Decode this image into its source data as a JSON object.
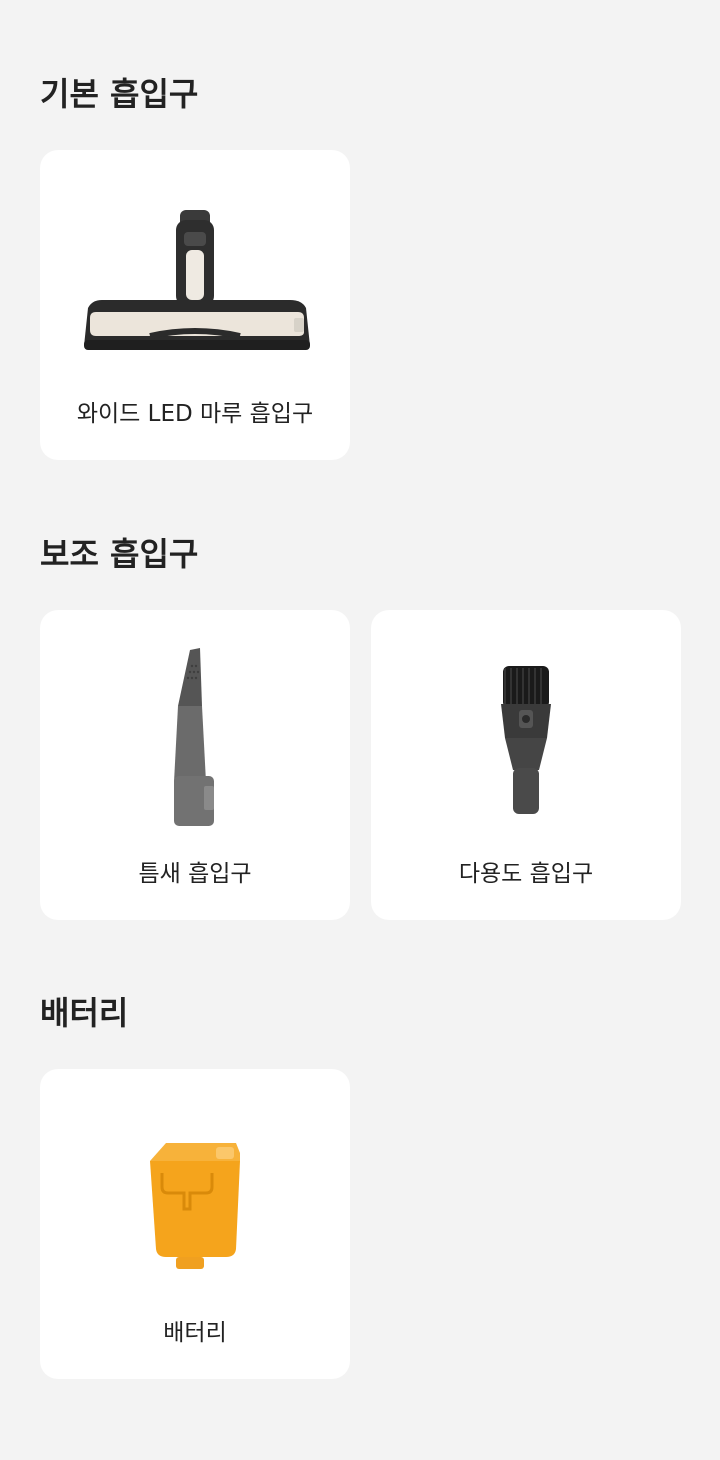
{
  "sections": [
    {
      "title": "기본 흡입구",
      "items": [
        {
          "label": "와이드 LED 마루 흡입구",
          "icon": "floor-nozzle-icon"
        }
      ]
    },
    {
      "title": "보조 흡입구",
      "items": [
        {
          "label": "틈새 흡입구",
          "icon": "crevice-tool-icon"
        },
        {
          "label": "다용도 흡입구",
          "icon": "multi-purpose-brush-icon"
        }
      ]
    },
    {
      "title": "배터리",
      "items": [
        {
          "label": "배터리",
          "icon": "battery-icon"
        }
      ]
    }
  ],
  "colors": {
    "background": "#f3f3f3",
    "card": "#ffffff",
    "text": "#222222",
    "battery": "#f5a41c"
  }
}
